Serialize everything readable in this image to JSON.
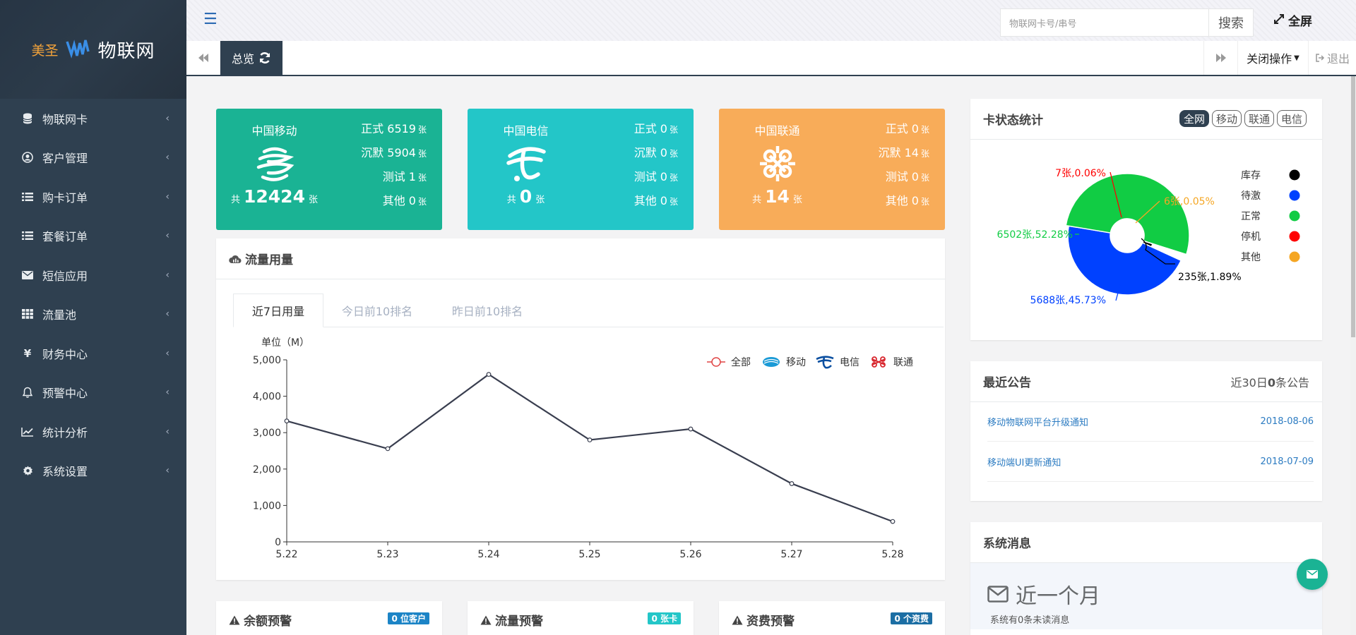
{
  "brand": {
    "name_cn": "美圣",
    "title": "物联网"
  },
  "sidebar": {
    "items": [
      {
        "label": "物联网卡",
        "icon": "database-icon"
      },
      {
        "label": "客户管理",
        "icon": "user-circle-icon"
      },
      {
        "label": "购卡订单",
        "icon": "list-icon"
      },
      {
        "label": "套餐订单",
        "icon": "list-icon"
      },
      {
        "label": "短信应用",
        "icon": "envelope-icon"
      },
      {
        "label": "流量池",
        "icon": "grid-icon"
      },
      {
        "label": "财务中心",
        "icon": "yen-icon"
      },
      {
        "label": "预警中心",
        "icon": "bell-icon"
      },
      {
        "label": "统计分析",
        "icon": "line-chart-icon"
      },
      {
        "label": "系统设置",
        "icon": "gear-icon"
      }
    ]
  },
  "topbar": {
    "search_placeholder": "物联网卡号/串号",
    "search_button": "搜索",
    "fullscreen_label": "全屏"
  },
  "tabsbar": {
    "active_tab": "总览",
    "close_ops": "关闭操作",
    "logout": "退出"
  },
  "carriers": [
    {
      "name": "中国移动",
      "total_prefix": "共",
      "total": "12424",
      "unit": "张",
      "color": "#1ab394",
      "stats": [
        {
          "label": "正式",
          "value": "6519"
        },
        {
          "label": "沉默",
          "value": "5904"
        },
        {
          "label": "测试",
          "value": "1"
        },
        {
          "label": "其他",
          "value": "0"
        }
      ]
    },
    {
      "name": "中国电信",
      "total_prefix": "共",
      "total": "0",
      "unit": "张",
      "color": "#23c6c8",
      "stats": [
        {
          "label": "正式",
          "value": "0"
        },
        {
          "label": "沉默",
          "value": "0"
        },
        {
          "label": "测试",
          "value": "0"
        },
        {
          "label": "其他",
          "value": "0"
        }
      ]
    },
    {
      "name": "中国联通",
      "total_prefix": "共",
      "total": "14",
      "unit": "张",
      "color": "#f8ac59",
      "stats": [
        {
          "label": "正式",
          "value": "0"
        },
        {
          "label": "沉默",
          "value": "14"
        },
        {
          "label": "测试",
          "value": "0"
        },
        {
          "label": "其他",
          "value": "0"
        }
      ]
    }
  ],
  "traffic": {
    "title": "流量用量",
    "tabs": [
      "近7日用量",
      "今日前10排名",
      "昨日前10排名"
    ],
    "active_tab": 0
  },
  "card_status": {
    "title": "卡状态统计",
    "filters": [
      "全网",
      "移动",
      "联通",
      "电信"
    ],
    "active_filter": 0
  },
  "announcements": {
    "title": "最近公告",
    "summary_prefix": "近30日",
    "summary_count": "0",
    "summary_suffix": "条公告",
    "items": [
      {
        "title": "移动物联网平台升级通知",
        "date": "2018-08-06"
      },
      {
        "title": "移动端UI更新通知",
        "date": "2018-07-09"
      }
    ]
  },
  "system_messages": {
    "title": "系统消息",
    "period": "近一个月",
    "summary": "系统有0条未读消息"
  },
  "warnings": [
    {
      "title": "余额预警",
      "badge": "0 位客户",
      "color": "#1c84c6"
    },
    {
      "title": "流量预警",
      "badge": "0 张卡",
      "color": "#23c6c8"
    },
    {
      "title": "资费预警",
      "badge": "0 个资费",
      "color": "#1c6ea4"
    }
  ],
  "chart_data": [
    {
      "type": "line",
      "title": "",
      "ylabel": "单位（M）",
      "xlabel": "",
      "categories": [
        "5.22",
        "5.23",
        "5.24",
        "5.25",
        "5.26",
        "5.27",
        "5.28"
      ],
      "series": [
        {
          "name": "全部",
          "values": [
            3320,
            2560,
            4600,
            2800,
            3100,
            1600,
            560
          ],
          "color": "#393e4f"
        }
      ],
      "legend": [
        "全部",
        "移动",
        "电信",
        "联通"
      ],
      "ylim": [
        0,
        5000
      ],
      "yticks": [
        "0",
        "1,000",
        "2,000",
        "3,000",
        "4,000",
        "5,000"
      ],
      "legend_position": "top-right"
    },
    {
      "type": "pie",
      "title": "",
      "variant": "rose",
      "slices": [
        {
          "name": "库存",
          "value": 235,
          "label": "235张,1.89%",
          "color": "#000000"
        },
        {
          "name": "待激",
          "value": 5688,
          "label": "5688张,45.73%",
          "color": "#0041ff"
        },
        {
          "name": "正常",
          "value": 6502,
          "label": "6502张,52.28%",
          "color": "#11cc44"
        },
        {
          "name": "停机",
          "value": 7,
          "label": "7张,0.06%",
          "color": "#ff0000"
        },
        {
          "name": "其他",
          "value": 6,
          "label": "6张,0.05%",
          "color": "#f5a623"
        }
      ],
      "legend_position": "right"
    }
  ]
}
